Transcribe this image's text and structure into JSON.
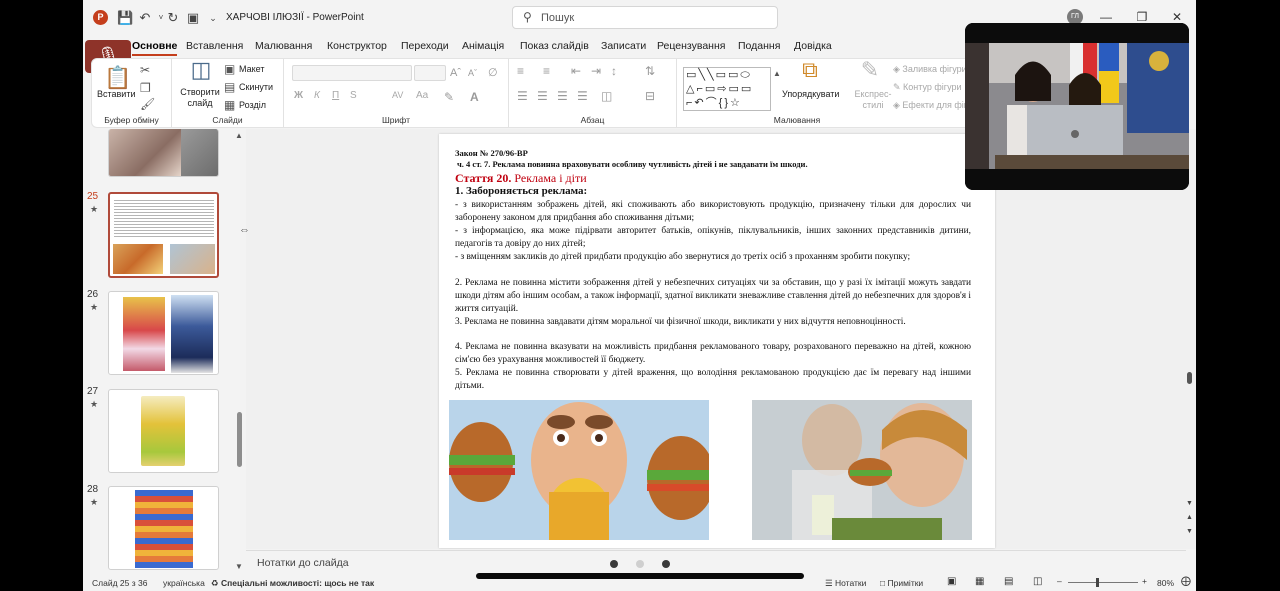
{
  "window": {
    "doc_title": "ХАРЧОВІ ІЛЮЗІЇ",
    "app_name": "PowerPoint",
    "separator": "-",
    "search_placeholder": "Пошук",
    "user_initials": "ГЛ",
    "accent_color": "#c43e1c"
  },
  "menu": {
    "tabs": [
      {
        "label": "Основне",
        "active": true
      },
      {
        "label": "Вставлення"
      },
      {
        "label": "Малювання"
      },
      {
        "label": "Конструктор"
      },
      {
        "label": "Переходи"
      },
      {
        "label": "Анімація"
      },
      {
        "label": "Показ слайдів"
      },
      {
        "label": "Записати"
      },
      {
        "label": "Рецензування"
      },
      {
        "label": "Подання"
      },
      {
        "label": "Довідка"
      }
    ]
  },
  "ribbon": {
    "clipboard": {
      "paste_label": "Вставити",
      "group_label": "Буфер обміну"
    },
    "slides": {
      "new_slide_label": "Створити слайд",
      "layout_label": "Макет",
      "reset_label": "Скинути",
      "section_label": "Розділ",
      "group_label": "Слайди"
    },
    "font": {
      "group_label": "Шрифт",
      "bold": "Ж",
      "italic": "К",
      "underline": "П",
      "strike": "S",
      "spacing": "AV",
      "case": "Aa"
    },
    "paragraph": {
      "group_label": "Абзац"
    },
    "drawing": {
      "arrange_label": "Упорядкувати",
      "quick_styles_label": "Експрес-стилі",
      "fill_label": "Заливка фігури",
      "outline_label": "Контур фігури",
      "effects_label": "Ефекти для фігур",
      "group_label": "Малювання"
    }
  },
  "thumbnails": [
    {
      "number": "25",
      "star": "★",
      "selected": true
    },
    {
      "number": "26",
      "star": "★"
    },
    {
      "number": "27",
      "star": "★"
    },
    {
      "number": "28",
      "star": "★"
    }
  ],
  "slide": {
    "law_title": "Закон № 270/96-ВР",
    "law_sub": "ч. 4 ст. 7.  Реклама повинна враховувати особливу чутливість дітей і не завдавати їм шкоди.",
    "article_prefix": "Стаття 20.",
    "article_name": "Реклама і діти",
    "ban_title": "1. Забороняється реклама:",
    "paragraphs": [
      "- з використанням зображень дітей, які споживають або використовують продукцію, призначену тільки для дорослих чи заборонену законом для придбання або споживання дітьми;",
      "- з інформацією, яка може підірвати авторитет батьків, опікунів, піклувальників, інших законних представників дитини, педагогів та довіру до них дітей;",
      "- з вміщенням закликів до дітей придбати продукцію або звернутися до третіх осіб з проханням зробити покупку;",
      "2. Реклама не повинна містити зображення дітей у небезпечних ситуаціях чи за обставин, що у разі їх імітації можуть завдати шкоди дітям або іншим особам, а також інформації, здатної викликати зневажливе ставлення дітей до небезпечних для здоров'я і життя ситуацій.",
      "3.  Реклама  не  повинна  завдавати  дітям  моральної  чи  фізичної  шкоди,  викликати  у  них  відчуття неповноцінності.",
      "4. Реклама не повинна вказувати на можливість придбання рекламованого товару, розрахованого переважно на дітей, кожною сім'єю без урахування можливостей її бюджету.",
      "5. Реклама не повинна створювати у дітей враження, що володіння рекламованою продукцією дає їм перевагу над іншими дітьми."
    ]
  },
  "notes": {
    "label": "Нотатки до слайда"
  },
  "status": {
    "slide_counter": "Слайд 25 з 36",
    "language": "українська",
    "accessibility": "Спеціальні можливості: щось не так",
    "notes_btn": "Нотатки",
    "comments_btn": "Примітки",
    "zoom": "80%"
  }
}
